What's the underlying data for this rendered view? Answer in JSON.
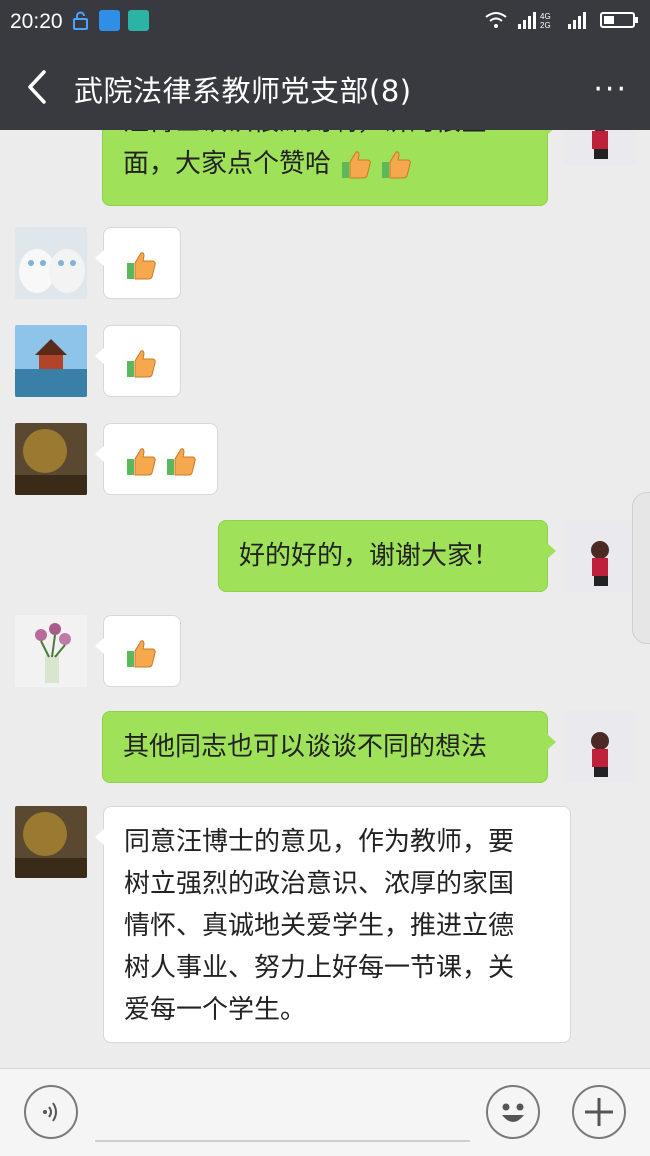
{
  "status_bar": {
    "time": "20:20",
    "network": "4G 2G"
  },
  "header": {
    "title": "武院法律系教师党支部(8)",
    "more_label": "···"
  },
  "messages": [
    {
      "side": "right",
      "text": "汪博士认识很深刻啊，讲的很全面，大家点个赞哈",
      "thumbs": 2,
      "avatar": "snow-portrait-avatar"
    },
    {
      "side": "left",
      "text": "",
      "thumbs": 1,
      "avatar": "white-cats-avatar"
    },
    {
      "side": "left",
      "text": "",
      "thumbs": 1,
      "avatar": "palace-tower-avatar"
    },
    {
      "side": "left",
      "text": "",
      "thumbs": 2,
      "avatar": "autumn-tree-avatar"
    },
    {
      "side": "right",
      "text": "好的好的，谢谢大家！",
      "thumbs": 0,
      "avatar": "snow-portrait-avatar"
    },
    {
      "side": "left",
      "text": "",
      "thumbs": 1,
      "avatar": "tulip-vase-avatar"
    },
    {
      "side": "right",
      "text": "其他同志也可以谈谈不同的想法",
      "thumbs": 0,
      "avatar": "snow-portrait-avatar"
    },
    {
      "side": "left",
      "lines": [
        "同意汪博士的意见，作为教师，要",
        "树立强烈的政治意识、浓厚的家国",
        "情怀、真诚地关爱学生，推进立德",
        "树人事业、努力上好每一节课，关",
        "爱每一个学生。"
      ],
      "thumbs": 0,
      "avatar": "autumn-tree-avatar"
    }
  ],
  "input_bar": {
    "voice_icon": "voice-icon",
    "emoji_icon": "emoji-icon",
    "plus_icon": "plus-icon"
  },
  "colors": {
    "bar": "#393a3f",
    "bg": "#ececec",
    "green_bubble": "#9fe25a",
    "white_bubble": "#ffffff"
  }
}
